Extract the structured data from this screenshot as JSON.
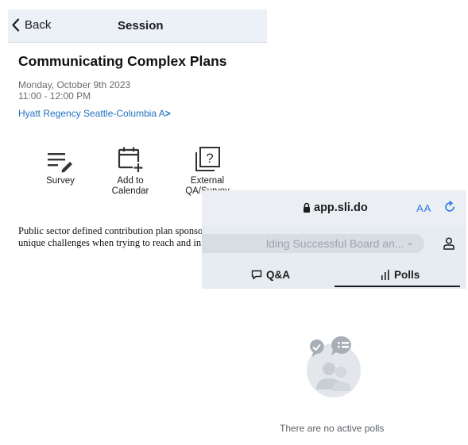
{
  "session_screen": {
    "nav": {
      "back_label": "Back",
      "title": "Session"
    },
    "title": "Communicating Complex Plans",
    "date": "Monday, October 9th 2023",
    "time": "11:00 - 12:00 PM",
    "location": "Hyatt Regency Seattle-Columbia A",
    "actions": [
      {
        "icon": "survey-icon",
        "label": "Survey"
      },
      {
        "icon": "calendar-add-icon",
        "label": "Add to\nCalendar"
      },
      {
        "icon": "external-qa-icon",
        "label": "External\nQA/Survey"
      }
    ],
    "description": "Public sector defined contribution plan sponsors face unique challenges when trying to reach and inform the"
  },
  "slido_screen": {
    "url": "app.sli.do",
    "text_size_label": "AA",
    "event_name": "lding Successful Board an...",
    "tabs": [
      {
        "icon": "chat-bubble-icon",
        "label": "Q&A",
        "active": false
      },
      {
        "icon": "bar-chart-icon",
        "label": "Polls",
        "active": true
      }
    ],
    "empty_message": "There are no active polls"
  },
  "colors": {
    "link_blue": "#1f6fbf",
    "safari_blue": "#2c7be5",
    "nav_bg": "#ebf1f6",
    "slido_bg": "#e7ecf0"
  }
}
